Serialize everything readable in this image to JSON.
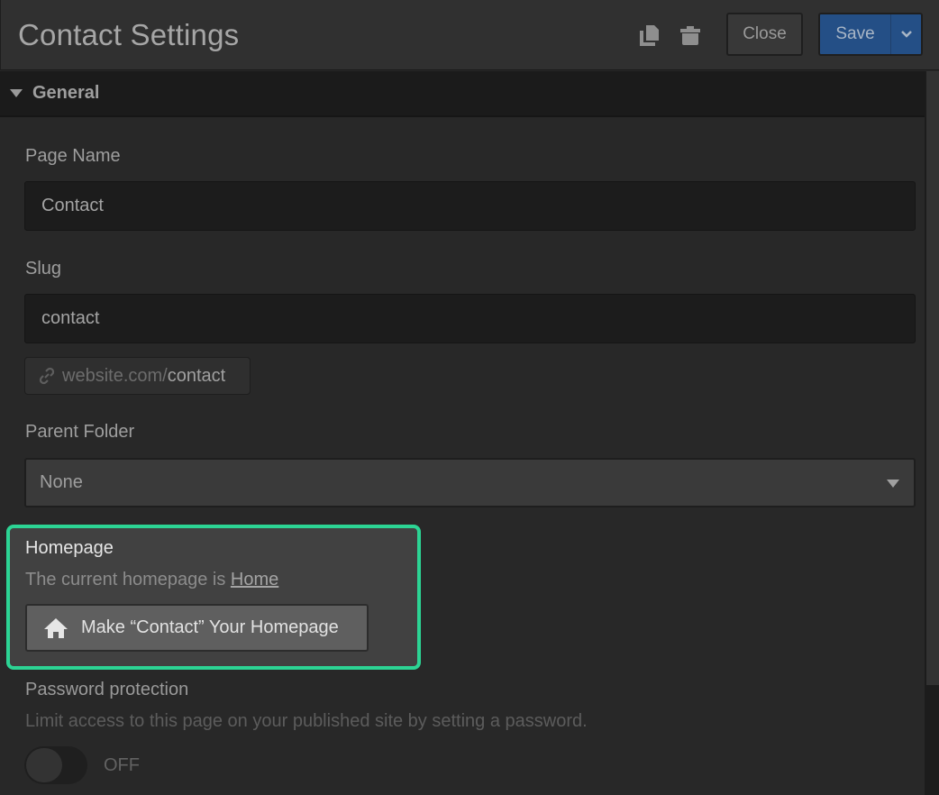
{
  "header": {
    "title": "Contact Settings",
    "icons": [
      "duplicate-icon",
      "trash-icon"
    ],
    "close_label": "Close",
    "save_label": "Save"
  },
  "section": {
    "title": "General",
    "expanded": true
  },
  "fields": {
    "page_name": {
      "label": "Page Name",
      "value": "Contact"
    },
    "slug": {
      "label": "Slug",
      "value": "contact"
    },
    "url_preview": {
      "base": "website.com/",
      "slug": "contact"
    },
    "parent_folder": {
      "label": "Parent Folder",
      "selected": "None"
    }
  },
  "homepage": {
    "label": "Homepage",
    "description_prefix": "The current homepage is ",
    "current_homepage_link": "Home",
    "make_homepage_button": "Make “Contact” Your Homepage",
    "highlight_color": "#2cd494"
  },
  "password": {
    "label": "Password protection",
    "description": "Limit access to this page on your published site by setting a password.",
    "toggle_state": "OFF"
  },
  "colors": {
    "save_button": "#244f86",
    "highlight": "#2cd494"
  }
}
